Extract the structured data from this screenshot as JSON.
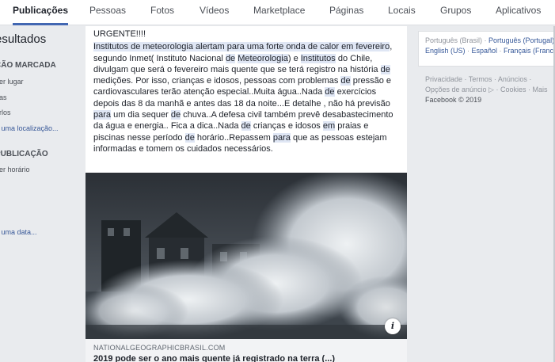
{
  "tabs": [
    {
      "label": "Publicações",
      "active": true
    },
    {
      "label": "Pessoas"
    },
    {
      "label": "Fotos"
    },
    {
      "label": "Vídeos"
    },
    {
      "label": "Marketplace"
    },
    {
      "label": "Páginas"
    },
    {
      "label": "Locais"
    },
    {
      "label": "Grupos"
    },
    {
      "label": "Aplicativos"
    }
  ],
  "filters": {
    "results_heading": "esultados",
    "location_heading": "ÇÃO MARCADA",
    "location_options": [
      "uer lugar",
      "nas",
      "arlos"
    ],
    "location_choose": "a uma localização...",
    "date_heading": "PUBLICAÇÃO",
    "date_any": "uer horário",
    "date_choose": "a uma data..."
  },
  "post": {
    "urgent": "URGENTE!!!!",
    "segments": [
      {
        "t": "Institutos de meteorologia alertam para uma forte onda de calor em fevereiro",
        "h": true
      },
      {
        "t": ", segundo Inmet( Instituto Nacional "
      },
      {
        "t": "de",
        "h": true
      },
      {
        "t": " "
      },
      {
        "t": "Meteorologia",
        "h": true
      },
      {
        "t": ") e "
      },
      {
        "t": "Institutos",
        "h": true
      },
      {
        "t": " do Chile, divulgam que será o fevereiro mais quente que se terá registro na história "
      },
      {
        "t": "de",
        "h": true
      },
      {
        "t": " medições. Por isso, crianças e idosos, pessoas com problemas "
      },
      {
        "t": "de",
        "h": true
      },
      {
        "t": " pressão e cardiovasculares terão atenção especial..Muita água..Nada "
      },
      {
        "t": "de",
        "h": true
      },
      {
        "t": " exercícios depois das 8 da manhã e antes das 18 da noite...E detalhe , não há previsão "
      },
      {
        "t": "para",
        "h": true
      },
      {
        "t": " um dia sequer "
      },
      {
        "t": "de",
        "h": true
      },
      {
        "t": " chuva..A defesa civil também prevê desabastecimento da água e energia.. Fica a dica..Nada "
      },
      {
        "t": "de",
        "h": true
      },
      {
        "t": " crianças e idosos "
      },
      {
        "t": "em",
        "h": true
      },
      {
        "t": " praias e piscinas nesse período "
      },
      {
        "t": "de",
        "h": true
      },
      {
        "t": " horário..Repassem "
      },
      {
        "t": "para",
        "h": true
      },
      {
        "t": " que as pessoas estejam informadas e tomem os cuidados necessários."
      }
    ],
    "photo_icon": "wave-crash-photo",
    "info_glyph": "i",
    "link_domain": "NATIONALGEOGRAPHICBRASIL.COM",
    "link_title": "2019 pode ser o ano mais quente já registrado na terra (...)"
  },
  "languages": {
    "current": "Português (Brasil)",
    "sep": " · ",
    "row1_link": "Português (Portugal)",
    "row2": [
      "English (US)",
      "Español",
      "Français (France)"
    ]
  },
  "footer": {
    "row1": "Privacidade · Termos · Anúncios ·",
    "row2": "Opções de anúncio ▷ · Cookies · Mais",
    "copyright": "Facebook © 2019"
  },
  "colors": {
    "accent": "#4267b2",
    "link": "#365899",
    "highlight": "#dfe6f4"
  }
}
